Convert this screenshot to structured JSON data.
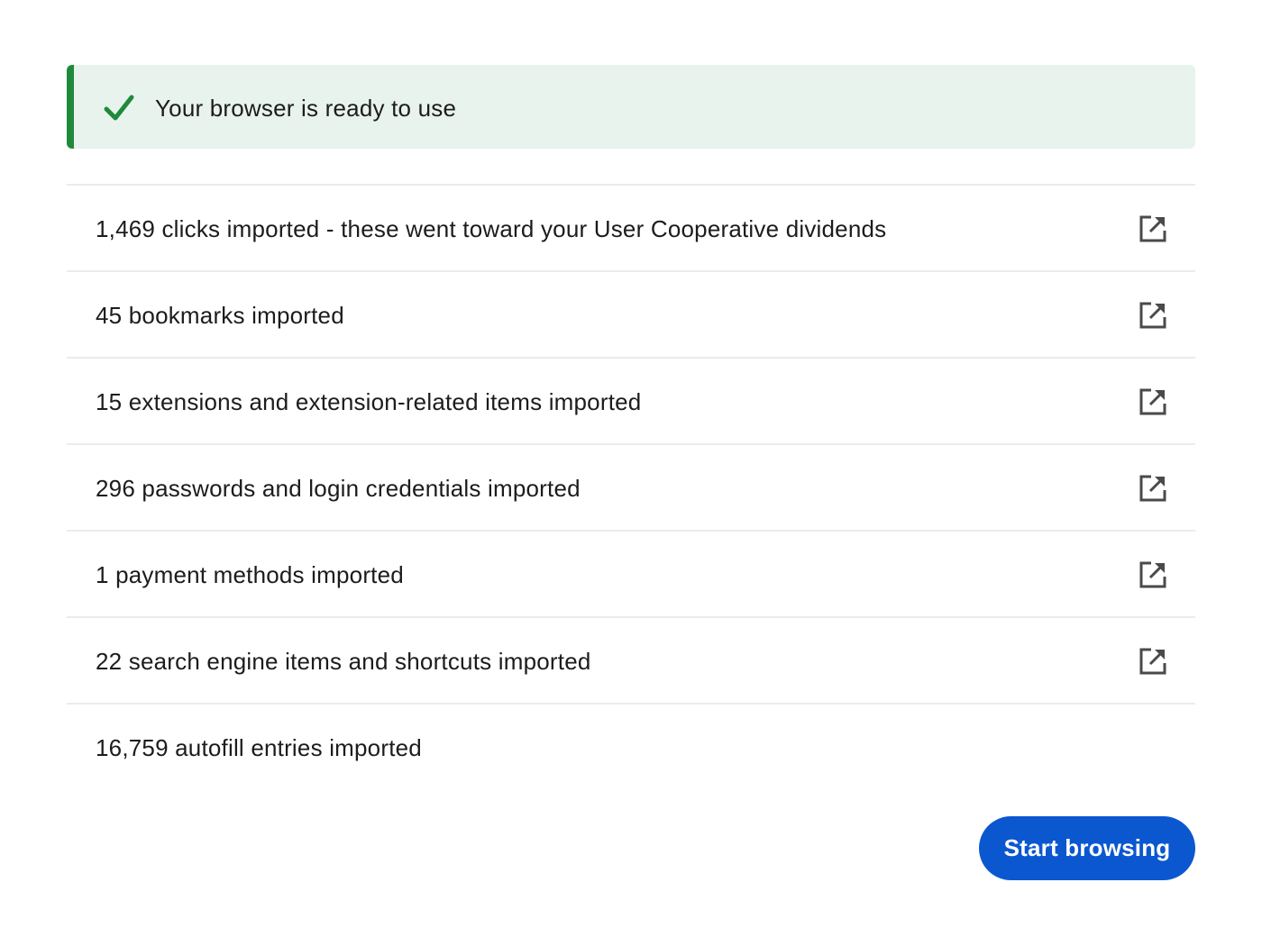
{
  "banner": {
    "icon": "checkmark-icon",
    "message": "Your browser is ready to use",
    "accent_color": "#1f8a3b",
    "background_color": "#e9f3ee"
  },
  "imports": [
    {
      "label": "1,469 clicks imported - these went toward your User Cooperative dividends",
      "icon": "external-link-icon"
    },
    {
      "label": "45 bookmarks imported",
      "icon": "external-link-icon"
    },
    {
      "label": "15 extensions and extension-related items imported",
      "icon": "external-link-icon"
    },
    {
      "label": "296 passwords and login credentials imported",
      "icon": "external-link-icon"
    },
    {
      "label": "1 payment methods imported",
      "icon": "external-link-icon"
    },
    {
      "label": "22 search engine items and shortcuts imported",
      "icon": "external-link-icon"
    },
    {
      "label": "16,759 autofill entries imported"
    }
  ],
  "actions": {
    "start_label": "Start browsing",
    "primary_color": "#0b57d0"
  }
}
